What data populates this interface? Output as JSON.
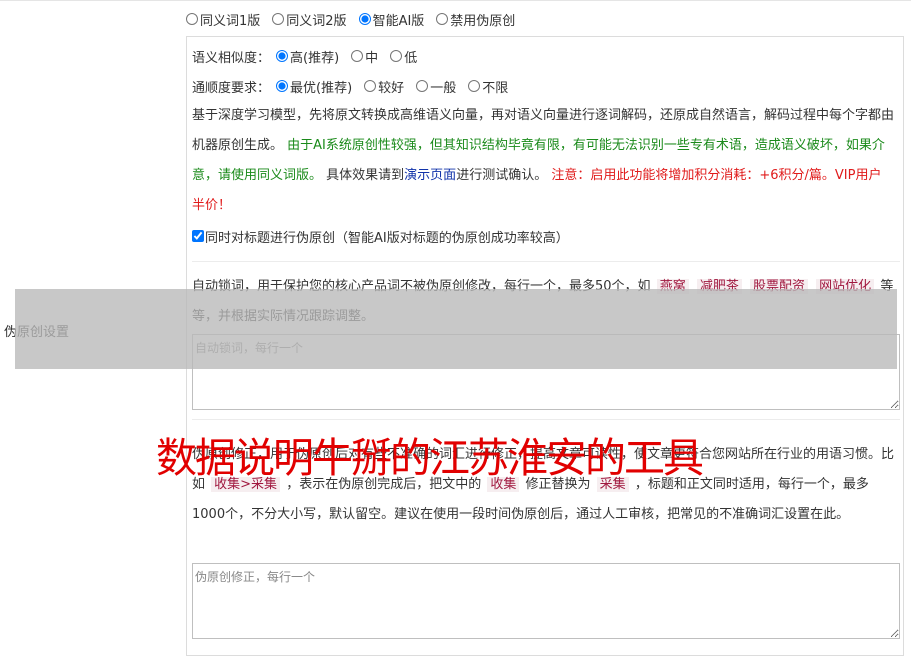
{
  "modes": [
    {
      "label": "同义词1版",
      "checked": false
    },
    {
      "label": "同义词2版",
      "checked": false
    },
    {
      "label": "智能AI版",
      "checked": true
    },
    {
      "label": "禁用伪原创",
      "checked": false
    }
  ],
  "section_label": "伪原创设置",
  "similarity": {
    "label": "语义相似度：",
    "options": [
      {
        "label": "高(推荐)",
        "checked": true
      },
      {
        "label": "中",
        "checked": false
      },
      {
        "label": "低",
        "checked": false
      }
    ]
  },
  "fluency": {
    "label": "通顺度要求：",
    "options": [
      {
        "label": "最优(推荐)",
        "checked": true
      },
      {
        "label": "较好",
        "checked": false
      },
      {
        "label": "一般",
        "checked": false
      },
      {
        "label": "不限",
        "checked": false
      }
    ]
  },
  "description": {
    "part1": "基于深度学习模型，先将原文转换成高维语义向量，再对语义向量进行逐词解码，还原成自然语言，解码过程中每个字都由机器原创生成。",
    "warning_green": "由于AI系统原创性较强，但其知识结构毕竟有限，有可能无法识别一些专有术语，造成语义破坏，如果介意，请使用同义词版。",
    "part2": "具体效果请到",
    "link": "演示页面",
    "part3": "进行测试确认。",
    "warning_red": "注意：启用此功能将增加积分消耗：+6积分/篇。VIP用户半价！"
  },
  "title_checkbox": {
    "label": "同时对标题进行伪原创（智能AI版对标题的伪原创成功率较高）",
    "checked": true
  },
  "lock": {
    "text1": "自动锁词，用于保护您的核心产品词不被伪原创修改，每行一个，最多50个，如",
    "examples": [
      "燕窝",
      "减肥茶",
      "股票配资",
      "网站优化"
    ],
    "text2": "等等，并根据实际情况跟踪调整。",
    "placeholder": "自动锁词，每行一个"
  },
  "fix": {
    "text1": "伪原创修正，用于伪原创后对有些不准确的词汇进行修正，提高文章可读性，使文章更符合您网站所在行业的用语习惯。比如",
    "example1": "收集>采集",
    "text2": "，表示在伪原创完成后，把文中的",
    "example2": "收集",
    "text3": "修正替换为",
    "example3": "采集",
    "text4": "，标题和正文同时适用，每行一个，最多1000个，不分大小写，默认留空。建议在使用一段时间伪原创后，通过人工审核，把常见的不准确词汇设置在此。",
    "placeholder": "伪原创修正，每行一个"
  },
  "watermark": "数据说明牛掰的江苏淮安的工具"
}
